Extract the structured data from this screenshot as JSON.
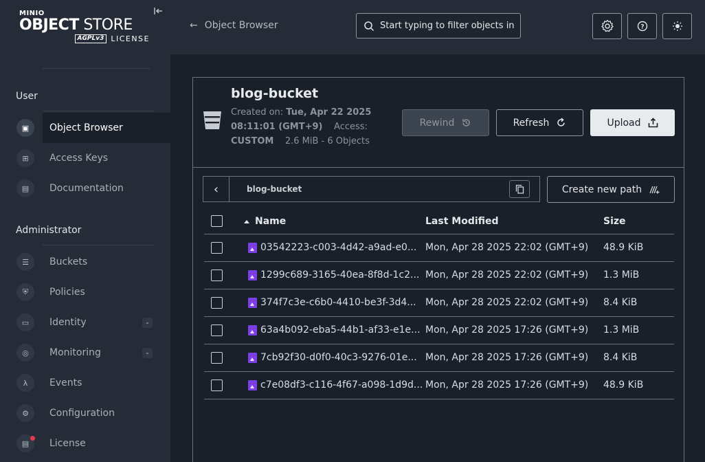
{
  "brand": {
    "minio": "MINIO",
    "product_bold": "OBJECT",
    "product_light": "STORE",
    "agpl": "AGPLv3",
    "license": "LICENSE"
  },
  "sidebar": {
    "user_section": "User",
    "admin_section": "Administrator",
    "user_items": [
      {
        "label": "Object Browser",
        "icon": "object-browser-icon"
      },
      {
        "label": "Access Keys",
        "icon": "access-keys-icon"
      },
      {
        "label": "Documentation",
        "icon": "documentation-icon"
      }
    ],
    "admin_items": [
      {
        "label": "Buckets",
        "icon": "buckets-icon"
      },
      {
        "label": "Policies",
        "icon": "policies-icon"
      },
      {
        "label": "Identity",
        "icon": "identity-icon"
      },
      {
        "label": "Monitoring",
        "icon": "monitoring-icon"
      },
      {
        "label": "Events",
        "icon": "events-icon"
      },
      {
        "label": "Configuration",
        "icon": "configuration-icon"
      },
      {
        "label": "License",
        "icon": "license-icon"
      }
    ]
  },
  "topbar": {
    "back_label": "Object Browser",
    "search_placeholder": "Start typing to filter objects in the bucket"
  },
  "bucket": {
    "name": "blog-bucket",
    "created_label": "Created on:",
    "created_value": "Tue, Apr 22 2025 08:11:01 (GMT+9)",
    "access_label": "Access:",
    "access_value": "CUSTOM",
    "usage": "2.6 MiB - 6 Objects",
    "rewind_label": "Rewind",
    "refresh_label": "Refresh",
    "upload_label": "Upload"
  },
  "browser": {
    "path": "blog-bucket",
    "new_path_label": "Create new path"
  },
  "table": {
    "headers": {
      "name": "Name",
      "modified": "Last Modified",
      "size": "Size"
    },
    "rows": [
      {
        "name": "03542223-c003-4d42-a9ad-e0...",
        "modified": "Mon, Apr 28 2025 22:02 (GMT+9)",
        "size": "48.9 KiB"
      },
      {
        "name": "1299c689-3165-40ea-8f8d-1c2...",
        "modified": "Mon, Apr 28 2025 22:02 (GMT+9)",
        "size": "1.3 MiB"
      },
      {
        "name": "374f7c3e-c6b0-4410-be3f-3d4...",
        "modified": "Mon, Apr 28 2025 22:02 (GMT+9)",
        "size": "8.4 KiB"
      },
      {
        "name": "63a4b092-eba5-44b1-af33-e1e...",
        "modified": "Mon, Apr 28 2025 17:26 (GMT+9)",
        "size": "1.3 MiB"
      },
      {
        "name": "7cb92f30-d0f0-40c3-9276-01e...",
        "modified": "Mon, Apr 28 2025 17:26 (GMT+9)",
        "size": "8.4 KiB"
      },
      {
        "name": "c7e08df3-c116-4f67-a098-1d9d...",
        "modified": "Mon, Apr 28 2025 17:26 (GMT+9)",
        "size": "48.9 KiB"
      }
    ]
  }
}
